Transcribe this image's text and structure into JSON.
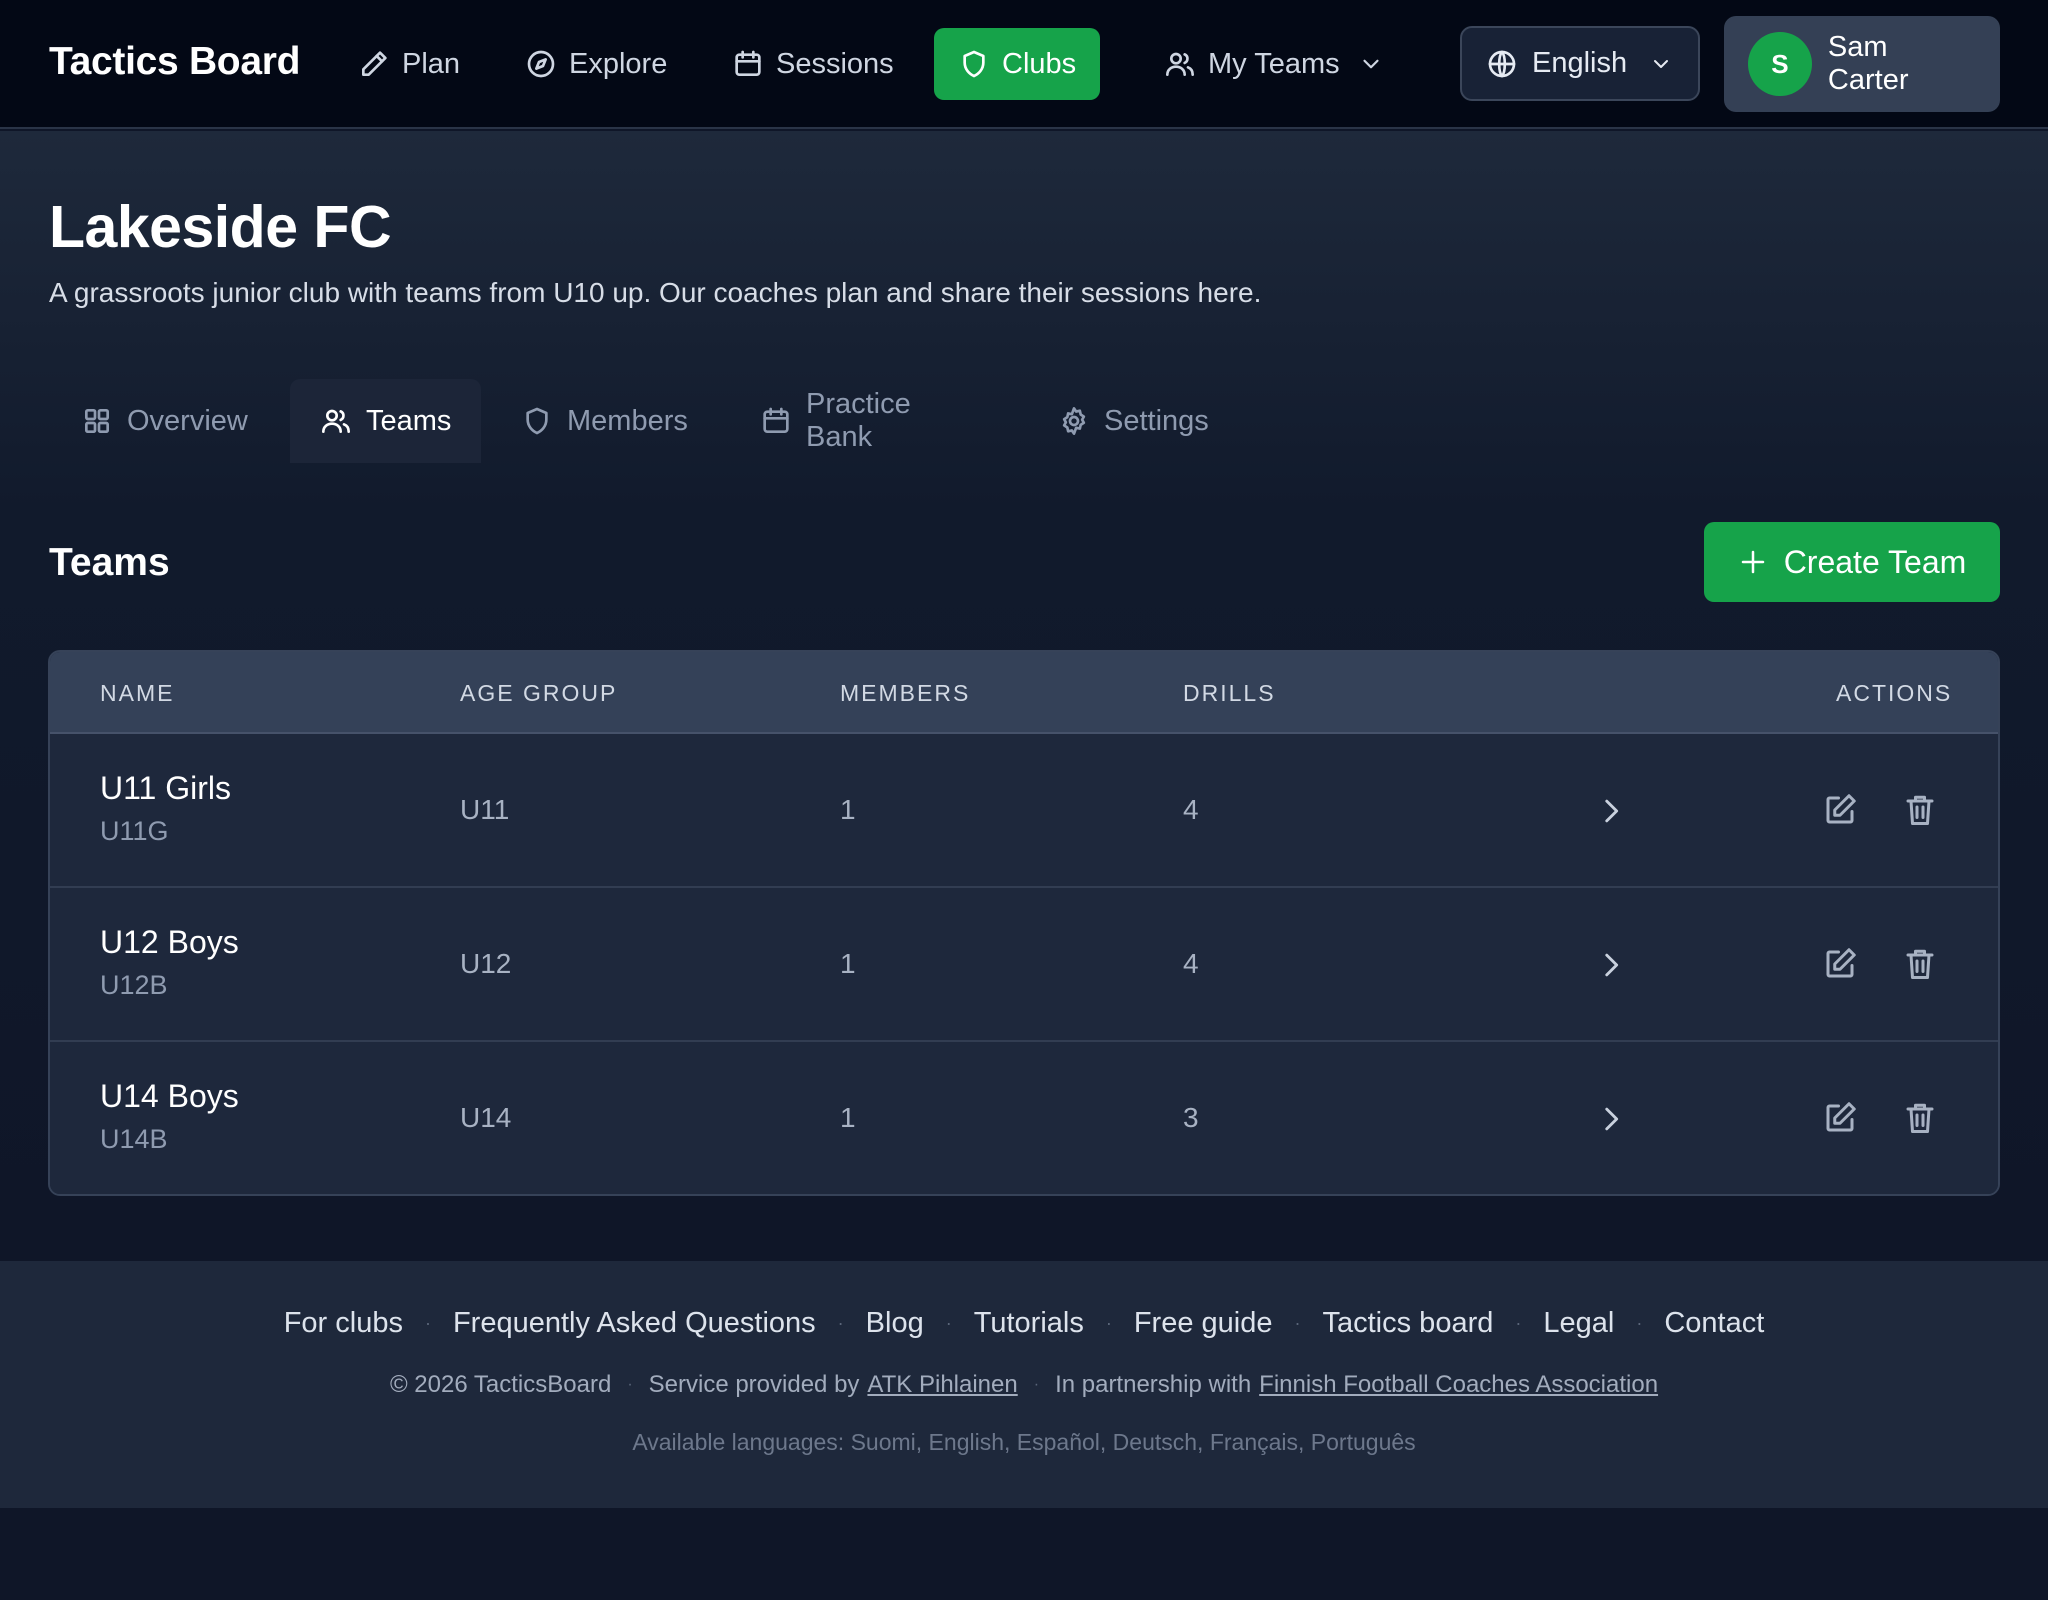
{
  "app": {
    "brand": "Tactics Board"
  },
  "nav": {
    "plan": "Plan",
    "explore": "Explore",
    "sessions": "Sessions",
    "clubs": "Clubs",
    "my_teams": "My Teams",
    "language": "English",
    "user_initial": "S",
    "user_name": "Sam Carter"
  },
  "colors": {
    "accent": "#16a34a",
    "topbar": "#030815",
    "surface": "#1e283c"
  },
  "club": {
    "name": "Lakeside FC",
    "description": "A grassroots junior club with teams from U10 up. Our coaches plan and share their sessions here."
  },
  "tabs": [
    {
      "label": "Overview",
      "icon": "grid-icon",
      "active": false
    },
    {
      "label": "Teams",
      "icon": "users-icon",
      "active": true
    },
    {
      "label": "Members",
      "icon": "shield-icon",
      "active": false
    },
    {
      "label": "Practice Bank",
      "icon": "calendar-icon",
      "active": false
    },
    {
      "label": "Settings",
      "icon": "gear-icon",
      "active": false
    }
  ],
  "teams_section": {
    "title": "Teams",
    "create_label": "Create Team",
    "columns": {
      "name": "NAME",
      "age_group": "AGE GROUP",
      "members": "MEMBERS",
      "drills": "DRILLS",
      "actions": "ACTIONS"
    },
    "rows": [
      {
        "name": "U11 Girls",
        "code": "U11G",
        "age_group": "U11",
        "members": "1",
        "drills": "4"
      },
      {
        "name": "U12 Boys",
        "code": "U12B",
        "age_group": "U12",
        "members": "1",
        "drills": "4"
      },
      {
        "name": "U14 Boys",
        "code": "U14B",
        "age_group": "U14",
        "members": "1",
        "drills": "3"
      }
    ]
  },
  "footer": {
    "links": [
      "For clubs",
      "Frequently Asked Questions",
      "Blog",
      "Tutorials",
      "Free guide",
      "Tactics board",
      "Legal",
      "Contact"
    ],
    "copyright": "© 2026 TacticsBoard",
    "service_prefix": "Service provided by",
    "service_link": "ATK Pihlainen",
    "partner_prefix": "In partnership with",
    "partner_link": "Finnish Football Coaches Association",
    "languages": "Available languages: Suomi, English, Español, Deutsch, Français, Português"
  }
}
